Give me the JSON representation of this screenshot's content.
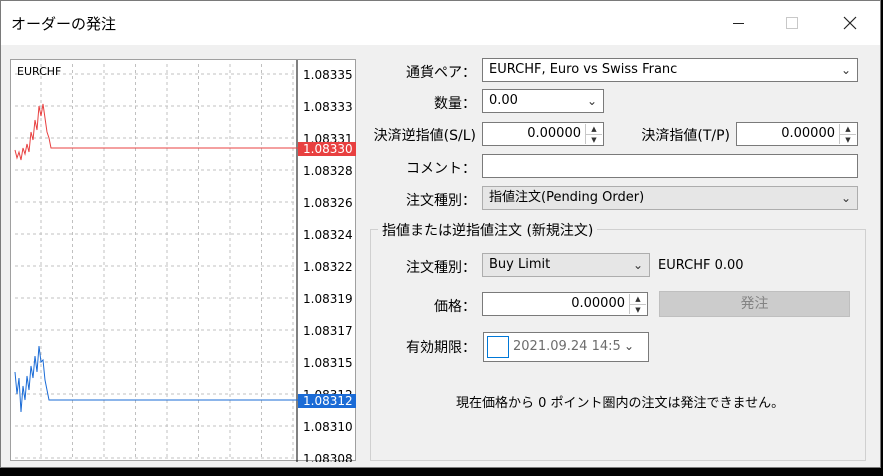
{
  "window": {
    "title": "オーダーの発注"
  },
  "chart": {
    "symbol": "EURCHF",
    "tick_labels": [
      "1.08335",
      "1.08333",
      "1.08331",
      "1.08328",
      "1.08326",
      "1.08324",
      "1.08322",
      "1.08319",
      "1.08317",
      "1.08315",
      "1.08312",
      "1.08310",
      "1.08308"
    ],
    "ask_price": "1.08330",
    "bid_price": "1.08312",
    "ask_color": "#e84040",
    "bid_color": "#1a6bd6"
  },
  "form": {
    "symbol_label": "通貨ペア：",
    "symbol_value": "EURCHF, Euro vs Swiss Franc",
    "volume_label": "数量：",
    "volume_value": "0.00",
    "sl_label": "決済逆指値(S/L)",
    "sl_value": "0.00000",
    "tp_label": "決済指値(T/P)",
    "tp_value": "0.00000",
    "comment_label": "コメント：",
    "comment_value": "",
    "order_type_label": "注文種別：",
    "order_type_value": "指値注文(Pending Order)"
  },
  "pending": {
    "group_title": "指値または逆指値注文 (新規注文)",
    "type_label": "注文種別：",
    "type_value": "Buy Limit",
    "info": "EURCHF 0.00",
    "price_label": "価格：",
    "price_value": "0.00000",
    "place_button": "発注",
    "expiry_label": "有効期限：",
    "expiry_value": "2021.09.24 14:5",
    "note": "現在価格から 0 ポイント圏内の注文は発注できません。"
  }
}
